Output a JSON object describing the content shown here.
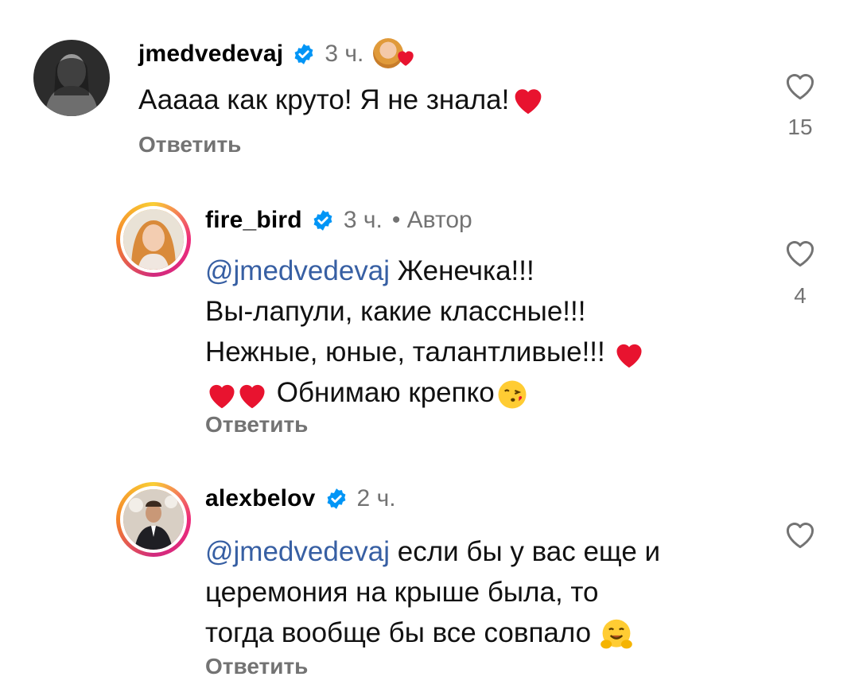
{
  "comments": [
    {
      "username": "jmedvedevaj",
      "time": "3 ч.",
      "text": "Ааааа как круто! Я не знала!",
      "reply_label": "Ответить",
      "likes": "15"
    },
    {
      "username": "fire_bird",
      "time": "3 ч.",
      "author_label": "• Автор",
      "mention": "@jmedvedevaj",
      "lines": [
        "Женечка!!!",
        "Вы-лапули, какие классные!!!",
        "Нежные, юные, талантливые!!!",
        "Обнимаю крепко"
      ],
      "reply_label": "Ответить",
      "likes": "4"
    },
    {
      "username": "alexbelov",
      "time": "2 ч.",
      "mention": "@jmedvedevaj",
      "lines": [
        "если бы у вас еще и",
        "церемония на крыше была, то",
        "тогда вообще бы все совпало"
      ],
      "reply_label": "Ответить"
    }
  ],
  "colors": {
    "verified": "#0095f6",
    "secondary_text": "#737373",
    "mention": "#375fa3",
    "heart_red": "#e8132f"
  },
  "icons": [
    "verified-badge-icon",
    "heart-outline-icon",
    "red-heart-emoji",
    "kiss-emoji",
    "hug-emoji"
  ]
}
